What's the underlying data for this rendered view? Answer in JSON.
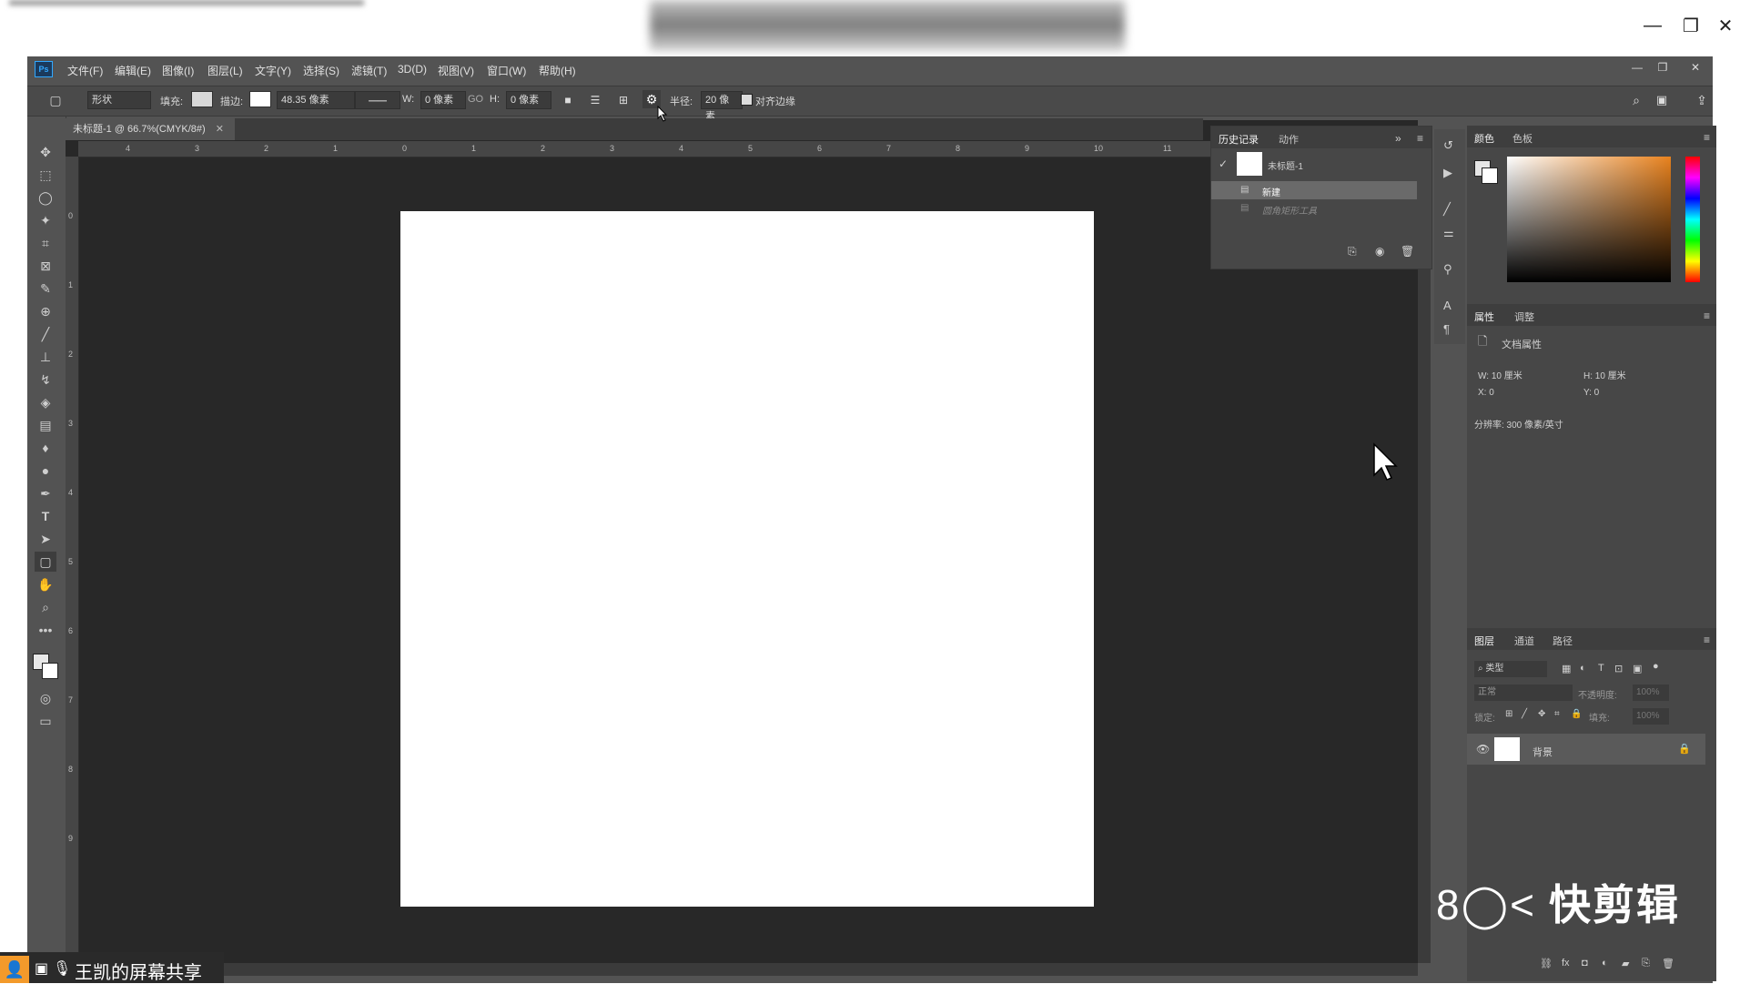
{
  "share_window": {
    "controls": [
      "—",
      "❐",
      "✕"
    ]
  },
  "ps": {
    "logo": "Ps",
    "menus": [
      "文件(F)",
      "编辑(E)",
      "图像(I)",
      "图层(L)",
      "文字(Y)",
      "选择(S)",
      "滤镜(T)",
      "3D(D)",
      "视图(V)",
      "窗口(W)",
      "帮助(H)"
    ],
    "window_controls": [
      "—",
      "❐",
      "✕"
    ],
    "options": {
      "mode": "形状",
      "fill_label": "填充:",
      "stroke_label": "描边:",
      "stroke_width": "48.35 像素",
      "w_label": "W:",
      "w_value": "0 像素",
      "link": "GO",
      "h_label": "H:",
      "h_value": "0 像素",
      "radius_label": "半径:",
      "radius_value": "20 像素",
      "align_edges": "对齐边缘"
    },
    "doc_tab": "未标题-1 @ 66.7%(CMYK/8#)",
    "ruler_h": [
      "4",
      "3",
      "2",
      "1",
      "0",
      "1",
      "2",
      "3",
      "4",
      "5",
      "6",
      "7",
      "8",
      "9",
      "10",
      "11"
    ],
    "ruler_v": [
      "0",
      "1",
      "2",
      "3",
      "4",
      "5",
      "6",
      "7",
      "8",
      "9"
    ],
    "history": {
      "tabs": [
        "历史记录",
        "动作"
      ],
      "snapshot": "未标题-1",
      "items": [
        "新建",
        "圆角矩形工具"
      ]
    },
    "color": {
      "tabs": [
        "颜色",
        "色板"
      ]
    },
    "properties": {
      "tabs": [
        "属性",
        "调整"
      ],
      "title": "文档属性",
      "w": "W:  10 厘米",
      "h": "H:  10 厘米",
      "x": "X:  0",
      "y": "Y:  0",
      "resolution": "分辨率: 300 像素/英寸"
    },
    "layers": {
      "tabs": [
        "图层",
        "通道",
        "路径"
      ],
      "filter": "类型",
      "blend": "正常",
      "opacity_label": "不透明度:",
      "opacity": "100%",
      "lock_label": "锁定:",
      "fill_label": "填充:",
      "fill": "100%",
      "layer_name": "背景"
    }
  },
  "bottom_share": "王凯的屏幕共享",
  "watermark": "快剪辑"
}
